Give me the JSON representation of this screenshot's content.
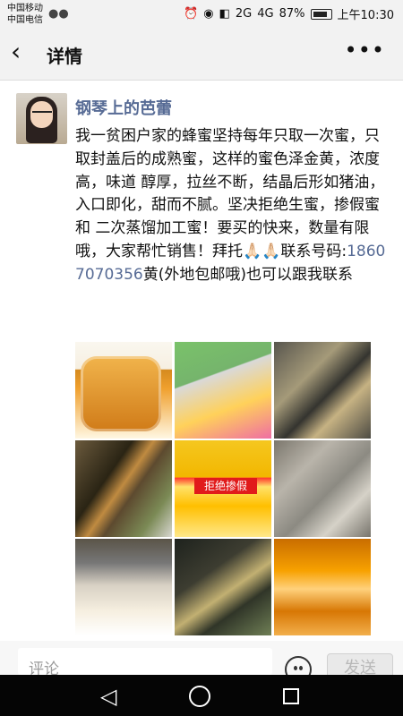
{
  "status": {
    "carrier_1": "中国移动",
    "carrier_2": "中国电信",
    "wechat_icon": "wechat-icon",
    "signal_label_1": "2G",
    "signal_label_2": "4G",
    "battery_percent": "87%",
    "time": "上午10:30"
  },
  "navbar": {
    "back_icon": "back-icon",
    "title": "详情",
    "more_icon": "more-icon"
  },
  "post": {
    "author": "钢琴上的芭蕾",
    "text_before_phone": "我一贫困户家的蜂蜜坚持每年只取一次蜜，只取封盖后的成熟蜜，这样的蜜色泽金黄，浓度高，味道 醇厚，拉丝不断，结晶后形如猪油，入口即化，甜而不腻。坚决拒绝生蜜，掺假蜜和 二次蒸馏加工蜜！要买的快来，数量有限哦，大家帮忙销售！拜托🙏🏻🙏🏻联系号码:",
    "phone": "18607070356",
    "text_after_phone": "黄(外地包邮哦)也可以跟我联系",
    "image_text": "拒绝掺假"
  },
  "comment": {
    "placeholder": "评论",
    "emoji_icon": "emoji-icon",
    "send_label": "发送"
  },
  "system_nav": {
    "back_icon": "triangle-back-icon",
    "home_icon": "circle-home-icon",
    "recent_icon": "square-recent-icon"
  }
}
